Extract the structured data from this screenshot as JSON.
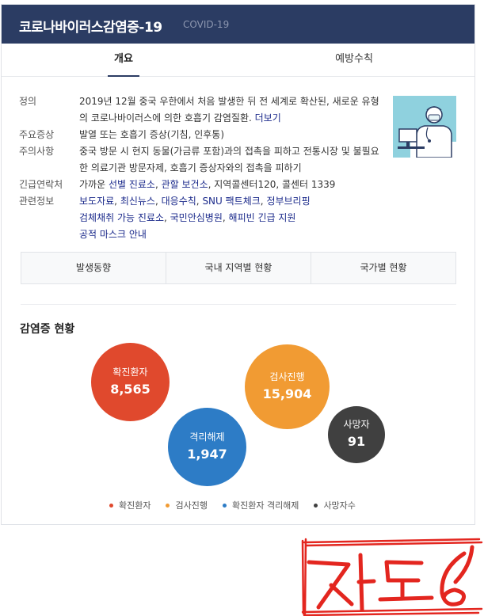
{
  "header": {
    "title": "코로나바이러스감염증-19",
    "subtitle": "COVID-19"
  },
  "tabs": [
    {
      "label": "개요",
      "active": true
    },
    {
      "label": "예방수칙",
      "active": false
    }
  ],
  "info": {
    "definition": {
      "label": "정의",
      "text": "2019년 12월 중국 우한에서 처음 발생한 뒤 전 세계로 확산된, 새로운 유형의 코로나바이러스에 의한 호흡기 감염질환.",
      "more": "더보기"
    },
    "symptoms": {
      "label": "주요증상",
      "text": "발열 또는 호흡기 증상(기침, 인후통)"
    },
    "cautions": {
      "label": "주의사항",
      "text": "중국 방문 시 현지 동물(가금류 포함)과의 접촉을 피하고 전통시장 및 불필요한 의료기관 방문자제, 호흡기 증상자와의 접촉을 피하기"
    },
    "contacts": {
      "label": "긴급연락처",
      "prefix": "가까운 ",
      "link1": "선별 진료소",
      "sep1": ", ",
      "link2": "관할 보건소",
      "suffix": ", 지역콜센터120, 콜센터 1339"
    },
    "related": {
      "label": "관련정보",
      "links": [
        "보도자료",
        "최신뉴스",
        "대응수칙",
        "SNU 팩트체크",
        "정부브리핑",
        "검체채취 가능 진료소",
        "국민안심병원",
        "해피빈 긴급 지원",
        "공적 마스크 안내"
      ]
    }
  },
  "buttons": [
    "발생동향",
    "국내 지역별 현황",
    "국가별 현황"
  ],
  "status": {
    "title": "감염증 현황",
    "bubbles": [
      {
        "label": "확진환자",
        "value": "8,565",
        "color": "#e0492d"
      },
      {
        "label": "검사진행",
        "value": "15,904",
        "color": "#f19b33"
      },
      {
        "label": "격리해제",
        "value": "1,947",
        "color": "#2d7cc6"
      },
      {
        "label": "사망자",
        "value": "91",
        "color": "#404040"
      }
    ],
    "legend": [
      {
        "label": "확진환자",
        "color": "#e0492d"
      },
      {
        "label": "검사진행",
        "color": "#f19b33"
      },
      {
        "label": "확진환자 격리해제",
        "color": "#2d7cc6"
      },
      {
        "label": "사망자수",
        "color": "#404040"
      }
    ]
  },
  "annotation": {
    "text": "지도6"
  }
}
